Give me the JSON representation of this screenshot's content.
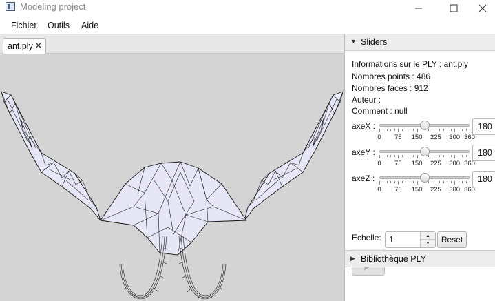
{
  "window": {
    "title": "Modeling project"
  },
  "menu": [
    "Fichier",
    "Outils",
    "Aide"
  ],
  "tab": {
    "label": "ant.ply",
    "close": "✕"
  },
  "panel": {
    "sliders_title": "Sliders",
    "library_title": "Bibliothèque PLY",
    "info": [
      "Informations sur le PLY : ant.ply",
      "Nombres points : 486",
      "Nombres faces : 912",
      "Auteur :",
      "Comment : null"
    ],
    "ticks": [
      "0",
      "75",
      "150",
      "225",
      "300",
      "360"
    ],
    "axes": [
      {
        "label": "axeX :",
        "value": 180,
        "display": "180"
      },
      {
        "label": "axeY :",
        "value": 180,
        "display": "180"
      },
      {
        "label": "axeZ :",
        "value": 180,
        "display": "180"
      }
    ],
    "slider_max": 360,
    "echelle_label": "Echelle:",
    "echelle_value": "1",
    "reset_label": "Reset"
  }
}
